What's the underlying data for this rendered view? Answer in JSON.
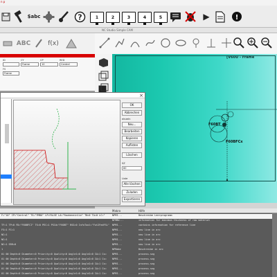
{
  "menubar": {
    "text": "n p"
  },
  "toolbar": {
    "save_sym": "🖫",
    "abc_label": "$abc",
    "monitors": [
      "1",
      "2",
      "3",
      "4",
      "5"
    ],
    "play": "▶",
    "alert": "!"
  },
  "left_panel": {
    "title": "",
    "abc_label": "ABC",
    "fx_label": "f(x)",
    "fields": {
      "row1_labels": [
        "ID",
        "CY",
        "CP",
        "RED"
      ],
      "row1_values": [
        "",
        "Frame",
        "10",
        "Centrel"
      ],
      "row2_label": "FS",
      "row2_value": "Frame"
    }
  },
  "drawing": {
    "title": "NC Studio Simple CAM",
    "frame_label": "[V60U - Frame",
    "label_a": "F60BT",
    "label_b": "F60BFCx"
  },
  "dialog": {
    "buttons": [
      "OK",
      "Abbrechen",
      "Neu...",
      "Bearbeiten",
      "Kopieren",
      "Auflisten",
      "Löschen"
    ],
    "label_einzeln": "einzeln",
    "label_sz": "SZ",
    "sz_value": "60",
    "label_liste": "Liste",
    "list_buttons": [
      "Alle löschen",
      "Zuladen",
      "Exportieren"
    ]
  },
  "output": {
    "headers": [
      "Makro",
      "Hilfe"
    ],
    "rows": [
      {
        "c1": "F=\"10\" CP=\"Central\" TS=\"FMBU\" LP=FALSE LA=\"Rauheneinlie\" TN=0 TA=0 LC=\"",
        "c2": "NPMI...",
        "c3": "Beschreibe Leerprogramm"
      },
      {
        "c1": "",
        "c2": "NFMBU...",
        "c3": "information for maximum thickness of raw material"
      },
      {
        "c1": "TF=1 TP=0 FD=\"F60BFCI\" TS=0 PEC=1 PSCd=\"F60BT\" RSG=0 InfoTool=\"Fut2FedFSi\" LP=",
        "c2": "NPMI...",
        "c3": "contains information for reference line"
      },
      {
        "c1": "FS=1 FC=1",
        "c2": "NPMI...",
        "c3": "new line in arc"
      },
      {
        "c1": "NC=1",
        "c2": "NPMI...",
        "c3": "new line in arc"
      },
      {
        "c1": "NC=1",
        "c2": "NPMI...",
        "c3": "new line in arc"
      },
      {
        "c1": "NC=1 SRR=0",
        "c2": "NPMI...",
        "c3": "new line in arc"
      },
      {
        "c1": "1",
        "c2": "NPMake",
        "c3": "Beschreibe in arc"
      },
      {
        "c1": "01 00 Depth=0 Diameter=0 Priority=0 Quality=0 Angle1=0 Angle2=0 IA=1 Cs=",
        "c2": "NPMI...",
        "c3": "process.sng"
      },
      {
        "c1": "01 00 Depth=0 Diameter=0 Priority=0 Quality=0 Angle1=0 Angle2=0 IA=1 Cs=",
        "c2": "NPMI...",
        "c3": "process.sng"
      },
      {
        "c1": "01 00 Depth=0 Diameter=0 Priority=0 Quality=0 Angle1=0 Angle2=0 IA=1 Cs=",
        "c2": "NPMI...",
        "c3": "process.sng"
      },
      {
        "c1": "01 00 Depth=0 Diameter=0 Priority=0 Quality=0 Angle1=0 Angle2=0 IA=1 Cs=",
        "c2": "NPMI...",
        "c3": "process.sng"
      },
      {
        "c1": "01 00 Depth=0 Diameter=0 Priority=0 Quality=0 Angle1=0 Angle2=0 IA=1 Cs=",
        "c2": "NPMI...",
        "c3": "process.sng"
      }
    ]
  },
  "colors": {
    "canvas_start": "#13b7a0",
    "canvas_end": "#8fe9e4",
    "red_bar": "#d80000",
    "selection_blue": "#2080ff",
    "output_bg": "#5a5a5a"
  }
}
